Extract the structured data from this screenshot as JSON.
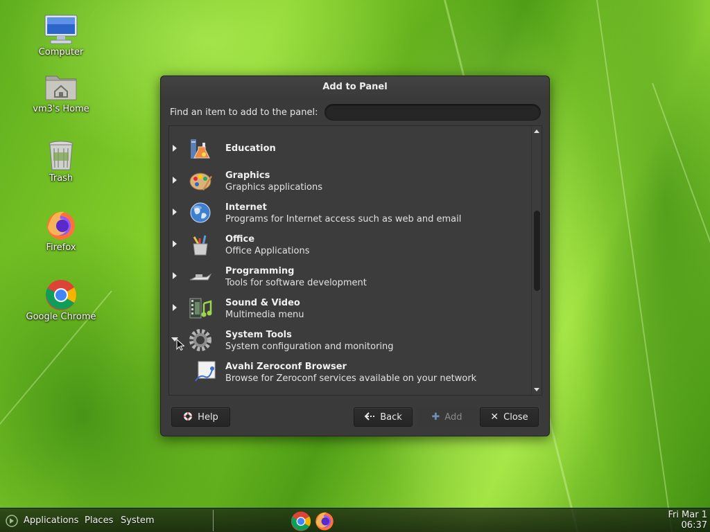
{
  "desktop": {
    "icons": [
      {
        "label": "Computer",
        "icon": "computer-icon"
      },
      {
        "label": "vm3's Home",
        "icon": "home-folder-icon"
      },
      {
        "label": "Trash",
        "icon": "trash-icon"
      },
      {
        "label": "Firefox",
        "icon": "firefox-icon"
      },
      {
        "label": "Google Chrome",
        "icon": "chrome-icon"
      }
    ]
  },
  "dialog": {
    "title": "Add to Panel",
    "find_label": "Find an item to add to the panel:",
    "search_value": "",
    "items": [
      {
        "name": "Education",
        "desc": "",
        "icon": "education-icon",
        "expanded": false
      },
      {
        "name": "Graphics",
        "desc": "Graphics applications",
        "icon": "graphics-icon",
        "expanded": false
      },
      {
        "name": "Internet",
        "desc": "Programs for Internet access such as web and email",
        "icon": "internet-globe-icon",
        "expanded": false
      },
      {
        "name": "Office",
        "desc": "Office Applications",
        "icon": "office-icon",
        "expanded": false
      },
      {
        "name": "Programming",
        "desc": "Tools for software development",
        "icon": "programming-icon",
        "expanded": false
      },
      {
        "name": "Sound & Video",
        "desc": "Multimedia menu",
        "icon": "sound-video-icon",
        "expanded": false
      },
      {
        "name": "System Tools",
        "desc": "System configuration and monitoring",
        "icon": "system-tools-icon",
        "expanded": true
      },
      {
        "name": "Avahi Zeroconf Browser",
        "desc": "Browse for Zeroconf services available on your network",
        "icon": "avahi-icon",
        "expanded": false
      }
    ],
    "buttons": {
      "help": "Help",
      "back": "Back",
      "add": "Add",
      "close": "Close"
    }
  },
  "taskbar": {
    "menus": [
      "Applications",
      "Places",
      "System"
    ],
    "launchers": [
      "chrome-icon",
      "firefox-icon"
    ],
    "clock_date": "Fri Mar 1",
    "clock_time": "06:37"
  }
}
